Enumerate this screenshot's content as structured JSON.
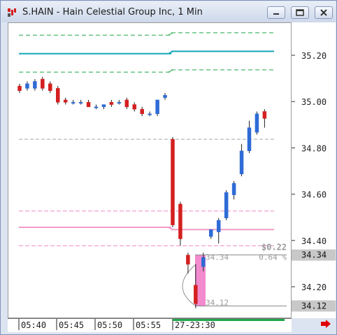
{
  "window": {
    "title": "S.HAIN - Hain Celestial Group Inc, 1 Min",
    "icon": "chart-app-icon",
    "buttons": [
      "minimize-button",
      "restore-button",
      "close-button"
    ]
  },
  "colors": {
    "up": "#2e6bd6",
    "down": "#d42020",
    "wick": "#222222",
    "band_green": "#1fa84a",
    "band_teal": "#14a8b8",
    "band_pink": "#f08ac8",
    "band_pink_mid": "#f29bc8",
    "band_gray": "#a8a8a8",
    "highlight": "#f075c5",
    "price_box": "#c8c8c8",
    "arrow": "#e00000",
    "session_bar": "#1fa84a"
  },
  "price_axis": {
    "labels": [
      "35.20",
      "35.00",
      "34.80",
      "34.60",
      "34.40",
      "34.20"
    ],
    "current_price": "34.34",
    "low_price": "34.12"
  },
  "time_axis": {
    "labels": [
      "05:40",
      "05:45",
      "05:50",
      "05:55",
      "27-23:30"
    ]
  },
  "measure": {
    "change": "$0.22",
    "percent": "0.64 %",
    "high": "34.34",
    "low": "34.12"
  },
  "chart_data": {
    "type": "candlestick",
    "title": "S.HAIN - Hain Celestial Group Inc, 1 Min",
    "ylim": [
      34.08,
      35.32
    ],
    "candles": [
      {
        "o": 35.07,
        "h": 35.08,
        "c": 35.05,
        "l": 35.04
      },
      {
        "o": 35.06,
        "h": 35.09,
        "c": 35.08,
        "l": 35.05
      },
      {
        "o": 35.06,
        "h": 35.1,
        "c": 35.09,
        "l": 35.05
      },
      {
        "o": 35.1,
        "h": 35.11,
        "c": 35.06,
        "l": 35.05
      },
      {
        "o": 35.08,
        "h": 35.09,
        "c": 35.05,
        "l": 35.04
      },
      {
        "o": 35.06,
        "h": 35.07,
        "c": 35.0,
        "l": 34.99
      },
      {
        "o": 35.01,
        "h": 35.02,
        "c": 35.0,
        "l": 34.99
      },
      {
        "o": 35.0,
        "h": 35.01,
        "c": 35.0,
        "l": 34.99
      },
      {
        "o": 35.0,
        "h": 35.01,
        "c": 35.0,
        "l": 34.99
      },
      {
        "o": 35.0,
        "h": 35.01,
        "c": 34.98,
        "l": 34.98
      },
      {
        "o": 34.98,
        "h": 34.99,
        "c": 34.98,
        "l": 34.97
      },
      {
        "o": 34.98,
        "h": 34.99,
        "c": 34.99,
        "l": 34.97
      },
      {
        "o": 35.0,
        "h": 35.01,
        "c": 34.99,
        "l": 34.98
      },
      {
        "o": 35.0,
        "h": 35.01,
        "c": 35.0,
        "l": 34.99
      },
      {
        "o": 35.01,
        "h": 35.02,
        "c": 34.98,
        "l": 34.97
      },
      {
        "o": 34.99,
        "h": 35.0,
        "c": 34.97,
        "l": 34.96
      },
      {
        "o": 34.97,
        "h": 34.98,
        "c": 34.95,
        "l": 34.94
      },
      {
        "o": 34.95,
        "h": 34.96,
        "c": 34.95,
        "l": 34.94
      },
      {
        "o": 34.95,
        "h": 35.01,
        "c": 35.01,
        "l": 34.94
      },
      {
        "o": 35.02,
        "h": 35.04,
        "c": 35.03,
        "l": 35.01
      },
      {
        "o": 34.84,
        "h": 34.85,
        "c": 34.47,
        "l": 34.46
      },
      {
        "o": 34.56,
        "h": 34.57,
        "c": 34.41,
        "l": 34.38
      },
      {
        "o": 34.34,
        "h": 34.35,
        "c": 34.3,
        "l": 34.26
      },
      {
        "o": 34.21,
        "h": 34.3,
        "c": 34.13,
        "l": 34.11
      },
      {
        "o": 34.29,
        "h": 34.35,
        "c": 34.33,
        "l": 34.27
      },
      {
        "o": 34.42,
        "h": 34.45,
        "c": 34.45,
        "l": 34.41
      },
      {
        "o": 34.44,
        "h": 34.5,
        "c": 34.49,
        "l": 34.39
      },
      {
        "o": 34.5,
        "h": 34.62,
        "c": 34.61,
        "l": 34.49
      },
      {
        "o": 34.6,
        "h": 34.66,
        "c": 34.65,
        "l": 34.58
      },
      {
        "o": 34.69,
        "h": 34.82,
        "c": 34.79,
        "l": 34.68
      },
      {
        "o": 34.79,
        "h": 34.92,
        "c": 34.89,
        "l": 34.78
      },
      {
        "o": 34.87,
        "h": 34.96,
        "c": 34.95,
        "l": 34.86
      },
      {
        "o": 34.96,
        "h": 34.97,
        "c": 34.93,
        "l": 34.89
      }
    ],
    "bands": [
      {
        "name": "upper-green",
        "y_before": 35.29,
        "y_after": 35.3
      },
      {
        "name": "mid-teal",
        "y_before": 35.21,
        "y_after": 35.22
      },
      {
        "name": "lower-green",
        "y_before": 35.13,
        "y_after": 35.14
      },
      {
        "name": "gray-line",
        "y": 34.84
      },
      {
        "name": "pink-upper",
        "y": 34.53
      },
      {
        "name": "pink-mid",
        "y_before": 34.46,
        "y_after": 34.45
      },
      {
        "name": "pink-lower",
        "y": 34.38
      }
    ]
  }
}
